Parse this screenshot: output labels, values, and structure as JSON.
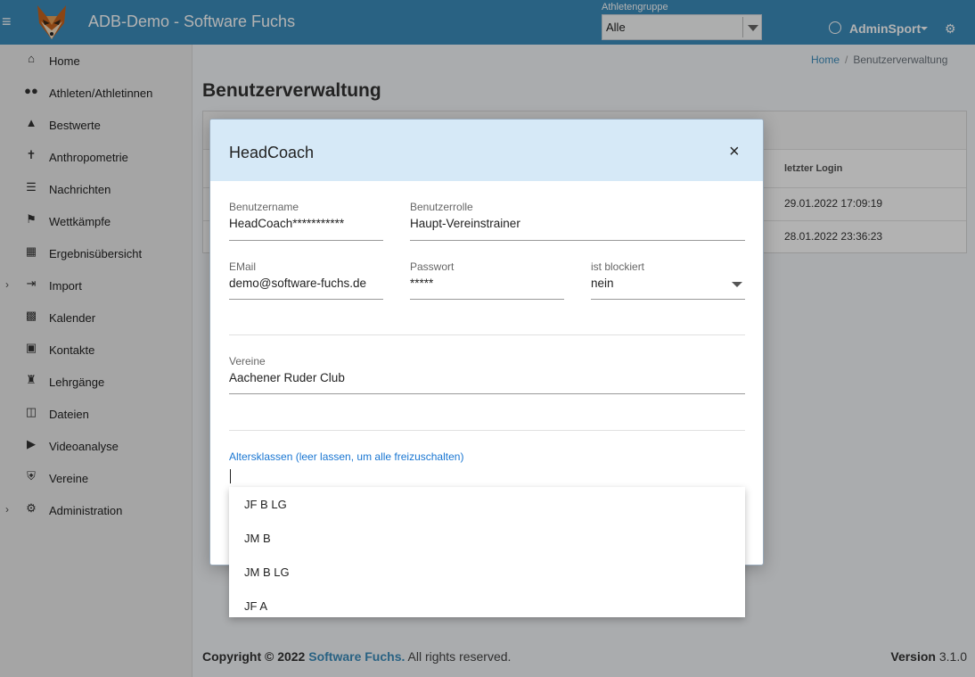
{
  "header": {
    "title": "ADB-Demo - Software Fuchs",
    "athletengruppe_label": "Athletengruppe",
    "athletengruppe_value": "Alle",
    "user": "AdminSport",
    "menu_icon": "hamburger-icon",
    "brand_color": "#3c8dbc"
  },
  "sidebar": {
    "items": [
      {
        "label": "Home",
        "icon": "home-icon"
      },
      {
        "label": "Athleten/Athletinnen",
        "icon": "users-icon"
      },
      {
        "label": "Bestwerte",
        "icon": "trophy-icon"
      },
      {
        "label": "Anthropometrie",
        "icon": "person-icon"
      },
      {
        "label": "Nachrichten",
        "icon": "list-icon"
      },
      {
        "label": "Wettkämpfe",
        "icon": "flag-checkered-icon"
      },
      {
        "label": "Ergebnisübersicht",
        "icon": "table-icon"
      },
      {
        "label": "Import",
        "icon": "import-icon",
        "expandable": true
      },
      {
        "label": "Kalender",
        "icon": "calendar-icon"
      },
      {
        "label": "Kontakte",
        "icon": "address-card-icon"
      },
      {
        "label": "Lehrgänge",
        "icon": "teacher-icon"
      },
      {
        "label": "Dateien",
        "icon": "files-icon"
      },
      {
        "label": "Videoanalyse",
        "icon": "video-icon"
      },
      {
        "label": "Vereine",
        "icon": "bank-icon"
      },
      {
        "label": "Administration",
        "icon": "cogs-icon",
        "expandable": true
      }
    ]
  },
  "breadcrumb": {
    "home": "Home",
    "separator": "/",
    "current": "Benutzerverwaltung"
  },
  "page": {
    "title": "Benutzerverwaltung",
    "table": {
      "column_last_login": "letzter Login",
      "rows": [
        {
          "last_login": "29.01.2022 17:09:19"
        },
        {
          "last_login": "28.01.2022 23:36:23"
        }
      ]
    }
  },
  "modal": {
    "title": "HeadCoach",
    "close": "×",
    "fields": {
      "username": {
        "label": "Benutzername",
        "value": "HeadCoach***********"
      },
      "role": {
        "label": "Benutzerrolle",
        "value": "Haupt-Vereinstrainer"
      },
      "email": {
        "label": "EMail",
        "value": "demo@software-fuchs.de"
      },
      "password": {
        "label": "Passwort",
        "value": "*****"
      },
      "blocked": {
        "label": "ist blockiert",
        "value": "nein"
      },
      "clubs": {
        "label": "Vereine",
        "value": "Aachener Ruder Club"
      },
      "age_classes": {
        "label": "Altersklassen (leer lassen, um alle freizuschalten)",
        "value": ""
      }
    },
    "age_class_options": [
      "JF B LG",
      "JM B",
      "JM B LG",
      "JF A"
    ]
  },
  "footer": {
    "copyright_prefix": "Copyright © 2022",
    "brand": "Software Fuchs.",
    "rights": "All rights reserved.",
    "version_label": "Version",
    "version_value": "3.1.0"
  }
}
